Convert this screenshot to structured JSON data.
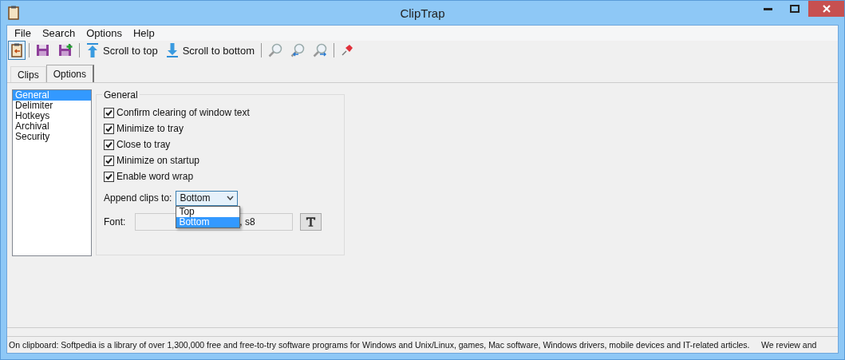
{
  "window": {
    "title": "ClipTrap"
  },
  "menu": [
    "File",
    "Search",
    "Options",
    "Help"
  ],
  "toolbar": [
    {
      "kind": "clipboard",
      "selected": true
    },
    {
      "kind": "save",
      "selected": false
    },
    {
      "kind": "save-add",
      "selected": false
    },
    {
      "kind": "up",
      "label": "Scroll to top",
      "selected": false
    },
    {
      "kind": "down",
      "label": "Scroll to bottom",
      "selected": false
    },
    {
      "kind": "zoom",
      "selected": false
    },
    {
      "kind": "zoom-out",
      "selected": false
    },
    {
      "kind": "zoom-reset",
      "selected": false
    },
    {
      "kind": "pin",
      "selected": false
    }
  ],
  "tabs": [
    {
      "label": "Clips",
      "selected": false
    },
    {
      "label": "Options",
      "selected": true
    }
  ],
  "categories": [
    {
      "label": "General",
      "selected": true
    },
    {
      "label": "Delimiter",
      "selected": false
    },
    {
      "label": "Hotkeys",
      "selected": false
    },
    {
      "label": "Archival",
      "selected": false
    },
    {
      "label": "Security",
      "selected": false
    }
  ],
  "group": {
    "title": "General",
    "checkboxes": [
      {
        "label": "Confirm clearing of window text",
        "checked": true
      },
      {
        "label": "Minimize to tray",
        "checked": true
      },
      {
        "label": "Close to tray",
        "checked": true
      },
      {
        "label": "Minimize on startup",
        "checked": true
      },
      {
        "label": "Enable word wrap",
        "checked": true
      }
    ],
    "append": {
      "label": "Append clips to:",
      "value": "Bottom",
      "expanded": true,
      "options": [
        {
          "label": "Top",
          "selected": false
        },
        {
          "label": "Bottom",
          "selected": true
        }
      ]
    },
    "font": {
      "label": "Font:",
      "value": ", s8"
    }
  },
  "status_bar": "On clipboard: Softpedia is a library of over 1,300,000 free and free-to-try software programs for Windows and Unix/Linux, games, Mac software, Windows drivers, mobile devices and IT-related articles.     We review and"
}
